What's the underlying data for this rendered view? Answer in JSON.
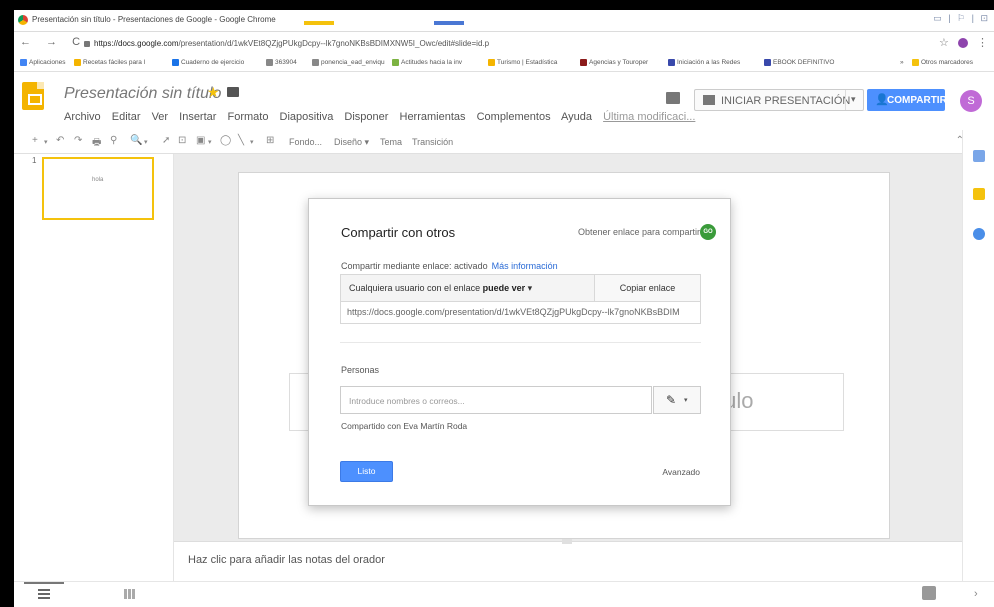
{
  "window": {
    "title": "Presentación sin título - Presentaciones de Google - Google Chrome",
    "controls": "▭ | ⚐ | ⊡"
  },
  "browser": {
    "nav_glyphs": "← → C",
    "url_host": "https://docs.google.com",
    "url_path": "/presentation/d/1wkVEt8QZjgPUkgDcpy--lk7gnoNKBsBDIMXNW5I_Owc/edit#slide=id.p",
    "star": "☆",
    "menu": "⋮"
  },
  "bookmarks": {
    "items": [
      {
        "label": "Aplicaciones",
        "color": "#4285f4"
      },
      {
        "label": "Recetas fáciles para l",
        "color": "#f4b400"
      },
      {
        "label": "Cuaderno de ejercicio",
        "color": "#1a73e8"
      },
      {
        "label": "363904",
        "color": "#888888"
      },
      {
        "label": "ponencia_ead_enviqu",
        "color": "#888888"
      },
      {
        "label": "Actitudes hacia la inv",
        "color": "#7cb342"
      },
      {
        "label": "Turismo | Estadística",
        "color": "#f4b400"
      },
      {
        "label": "Agencias y Touroper",
        "color": "#8b1a1a"
      },
      {
        "label": "Iniciación a las Redes",
        "color": "#3949ab"
      },
      {
        "label": "EBOOK DEFINITIVO",
        "color": "#3949ab"
      }
    ],
    "more": "»",
    "other": "Otros marcadores"
  },
  "header": {
    "doc_title": "Presentación sin título",
    "star_glyph": "★",
    "menu": [
      "Archivo",
      "Editar",
      "Ver",
      "Insertar",
      "Formato",
      "Diapositiva",
      "Disponer",
      "Herramientas",
      "Complementos",
      "Ayuda"
    ],
    "last_edit": "Última modificaci...",
    "present_label": "INICIAR PRESENTACIÓN",
    "present_caret": "▾",
    "share_label": "COMPARTIR",
    "share_glyph": "👤",
    "avatar_letter": "S"
  },
  "toolbar": {
    "glyphs": [
      "+",
      "▾",
      "↶",
      "↷",
      "🖶",
      "⚲",
      "🔍",
      "▾",
      "➚",
      "⊡",
      "▣",
      "▾",
      "◯",
      "╲",
      "▾",
      "⊞"
    ],
    "fondo": "Fondo...",
    "diseno": "Diseño ▾",
    "tema": "Tema",
    "transicion": "Transición",
    "collapse": "⌃"
  },
  "filmstrip": {
    "slide_number": "1",
    "thumb_text": "hola"
  },
  "slide": {
    "subtitle_placeholder": "tulo"
  },
  "notes": {
    "placeholder": "Haz clic para añadir las notas del orador"
  },
  "footer": {
    "chevron": "›"
  },
  "dialog": {
    "title": "Compartir con otros",
    "get_link": "Obtener enlace para compartir",
    "go_badge": "GO",
    "link_status": "Compartir mediante enlace: activado",
    "more_info": "Más información",
    "access_prefix": "Cualquiera usuario con el enlace",
    "access_bold": "puede ver",
    "access_caret": "▾",
    "copy_link": "Copiar enlace",
    "share_url": "https://docs.google.com/presentation/d/1wkVEt8QZjgPUkgDcpy--lk7gnoNKBsBDIM",
    "people_label": "Personas",
    "people_placeholder": "Introduce nombres o correos...",
    "pencil": "✎",
    "perm_caret": "▾",
    "shared_with": "Compartido con Eva Martín Roda",
    "done": "Listo",
    "advanced": "Avanzado"
  },
  "colors": {
    "share_blue": "#4d90fe",
    "slides_yellow": "#f4b400",
    "avatar_purple": "#c06ad6",
    "go_green": "#3a9b3a",
    "link_blue": "#2a6bd6"
  }
}
